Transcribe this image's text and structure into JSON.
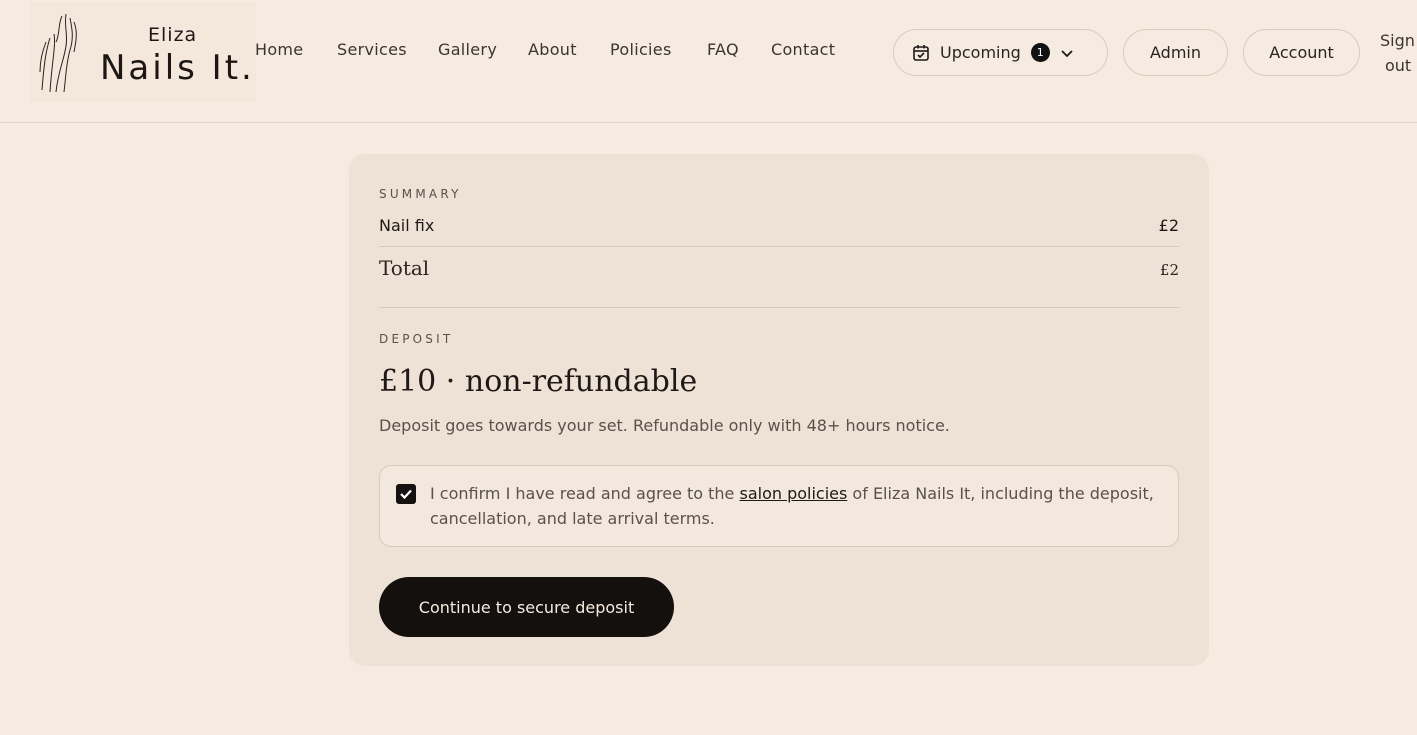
{
  "brand": {
    "small": "Eliza",
    "main": "Nails It."
  },
  "nav": {
    "items": [
      {
        "label": "Home"
      },
      {
        "label": "Services"
      },
      {
        "label": "Gallery"
      },
      {
        "label": "About"
      },
      {
        "label": "Policies"
      },
      {
        "label": "FAQ"
      },
      {
        "label": "Contact"
      }
    ]
  },
  "actions": {
    "upcoming": {
      "label": "Upcoming",
      "count": "1",
      "icon": "calendar-icon"
    },
    "admin": "Admin",
    "account": "Account",
    "signout_line1": "Sign",
    "signout_line2": "out"
  },
  "summary": {
    "label": "SUMMARY",
    "items": [
      {
        "name": "Nail fix",
        "price": "£2"
      }
    ],
    "total_label": "Total",
    "total_value": "£2"
  },
  "deposit": {
    "label": "DEPOSIT",
    "amount": "£10 · non-refundable",
    "note": "Deposit goes towards your set. Refundable only with 48+ hours notice."
  },
  "confirm": {
    "checked": true,
    "before": "I confirm I have read and agree to the ",
    "link": "salon policies",
    "after": " of Eliza Nails It, including the deposit, cancellation, and late arrival terms."
  },
  "cta": {
    "label": "Continue to secure deposit"
  },
  "colors": {
    "background": "#f6ebe0",
    "card": "#ede2d5",
    "primary": "#14100e"
  }
}
